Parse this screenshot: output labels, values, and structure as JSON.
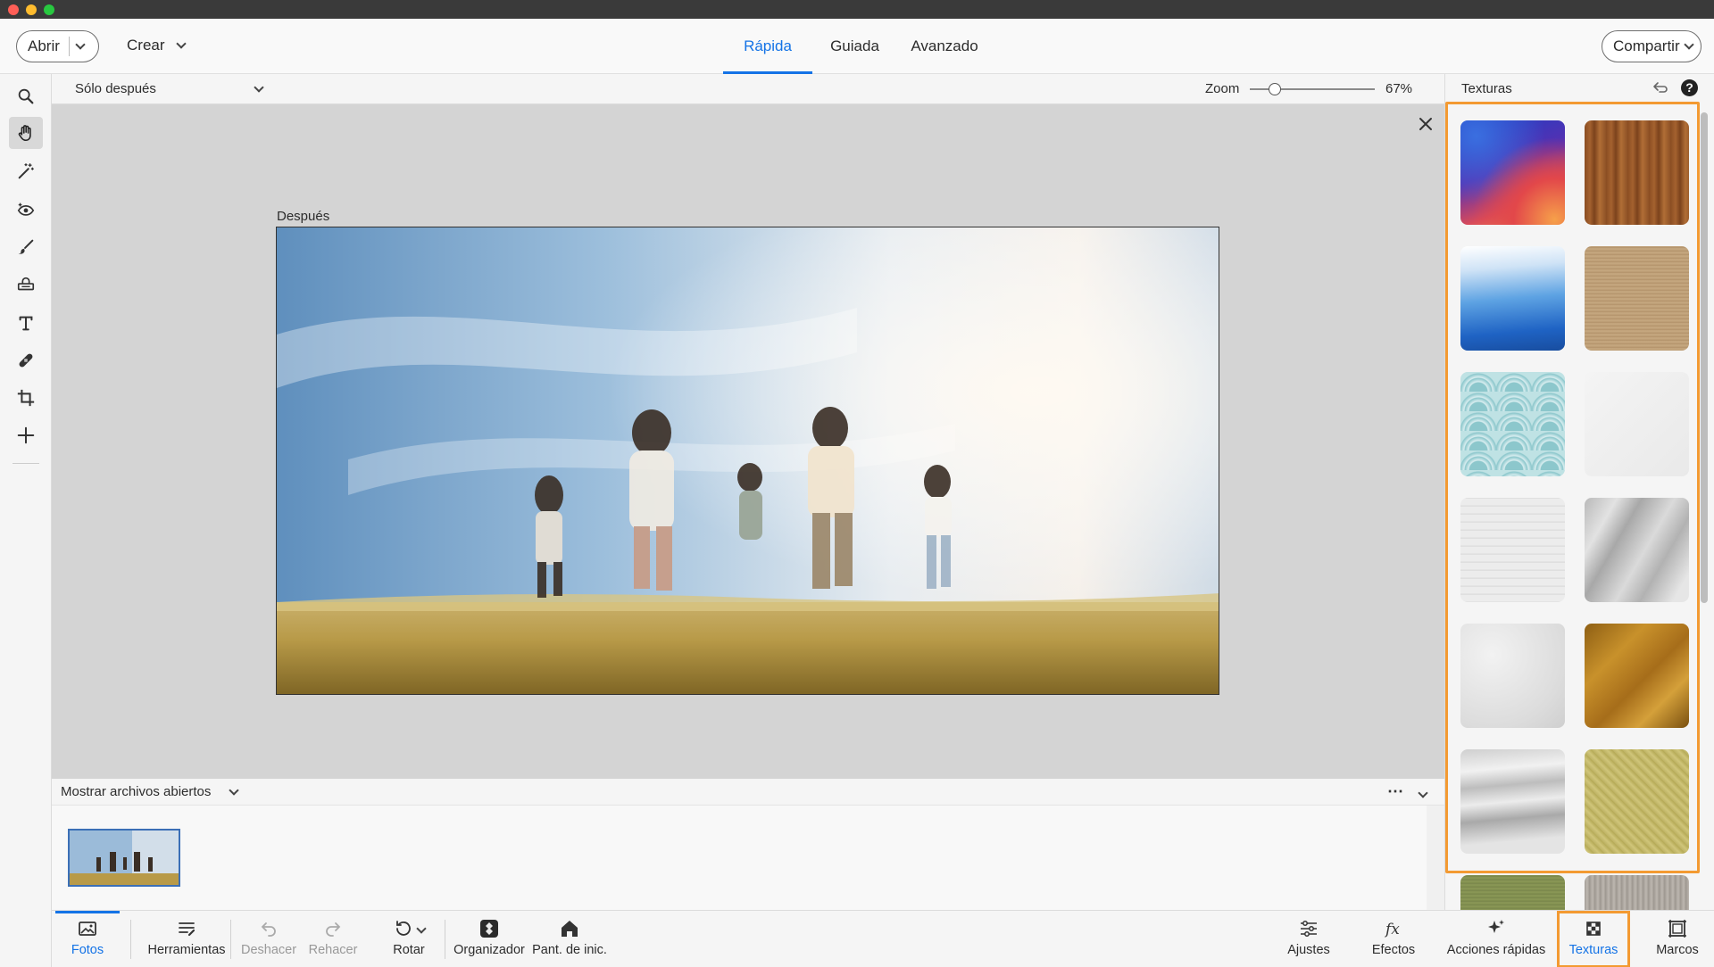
{
  "window": {
    "traffic_lights": {
      "close": "#ff5f57",
      "minimize": "#febc2e",
      "zoom": "#28c840"
    }
  },
  "header": {
    "open_label": "Abrir",
    "create_label": "Crear",
    "share_label": "Compartir",
    "modes": [
      {
        "label": "Rápida",
        "active": true
      },
      {
        "label": "Guiada",
        "active": false
      },
      {
        "label": "Avanzado",
        "active": false
      }
    ],
    "accent": "#1473e6"
  },
  "tools": [
    {
      "name": "zoom-tool",
      "icon": "magnifier-icon"
    },
    {
      "name": "hand-tool",
      "icon": "hand-icon",
      "active": true
    },
    {
      "name": "quick-selection-tool",
      "icon": "magic-wand-icon"
    },
    {
      "name": "red-eye-tool",
      "icon": "eye-icon"
    },
    {
      "name": "whiten-teeth-tool",
      "icon": "brush-icon"
    },
    {
      "name": "straighten-tool",
      "icon": "level-icon"
    },
    {
      "name": "type-tool",
      "icon": "type-icon"
    },
    {
      "name": "spot-healing-tool",
      "icon": "bandage-icon"
    },
    {
      "name": "crop-tool",
      "icon": "crop-icon"
    },
    {
      "name": "move-tool",
      "icon": "move-icon"
    }
  ],
  "options": {
    "view_select": "Sólo después",
    "zoom_label": "Zoom",
    "zoom_value": "67%",
    "zoom_level": 0.2
  },
  "canvas": {
    "photo_label": "Después"
  },
  "files": {
    "show_open_label": "Mostrar archivos abiertos"
  },
  "panel": {
    "title": "Texturas",
    "highlight_color": "#f39a32",
    "textures": [
      {
        "name": "gradient-blue-orange"
      },
      {
        "name": "wood-brown"
      },
      {
        "name": "blue-polygon"
      },
      {
        "name": "burlap-beige"
      },
      {
        "name": "teal-waves-pattern"
      },
      {
        "name": "white-paper"
      },
      {
        "name": "white-brick"
      },
      {
        "name": "crumpled-paper"
      },
      {
        "name": "white-plaster"
      },
      {
        "name": "gold-foil"
      },
      {
        "name": "cracked-paint"
      },
      {
        "name": "green-gold-pattern"
      },
      {
        "name": "green-fabric"
      },
      {
        "name": "grey-fabric"
      }
    ]
  },
  "bottombar": {
    "left": [
      {
        "label": "Fotos",
        "icon": "photos-icon",
        "active": true
      },
      {
        "label": "Herramientas",
        "icon": "tools-icon"
      },
      {
        "label": "Deshacer",
        "icon": "undo-icon",
        "disabled": true
      },
      {
        "label": "Rehacer",
        "icon": "redo-icon",
        "disabled": true
      },
      {
        "label": "Rotar",
        "icon": "rotate-icon"
      },
      {
        "label": "Organizador",
        "icon": "organizer-icon"
      },
      {
        "label": "Pant. de inic.",
        "icon": "home-icon"
      }
    ],
    "right": [
      {
        "label": "Ajustes",
        "icon": "sliders-icon"
      },
      {
        "label": "Efectos",
        "icon": "fx-icon"
      },
      {
        "label": "Acciones rápidas",
        "icon": "sparkle-icon"
      },
      {
        "label": "Texturas",
        "icon": "texture-icon",
        "active": true
      },
      {
        "label": "Marcos",
        "icon": "frame-icon"
      }
    ]
  }
}
